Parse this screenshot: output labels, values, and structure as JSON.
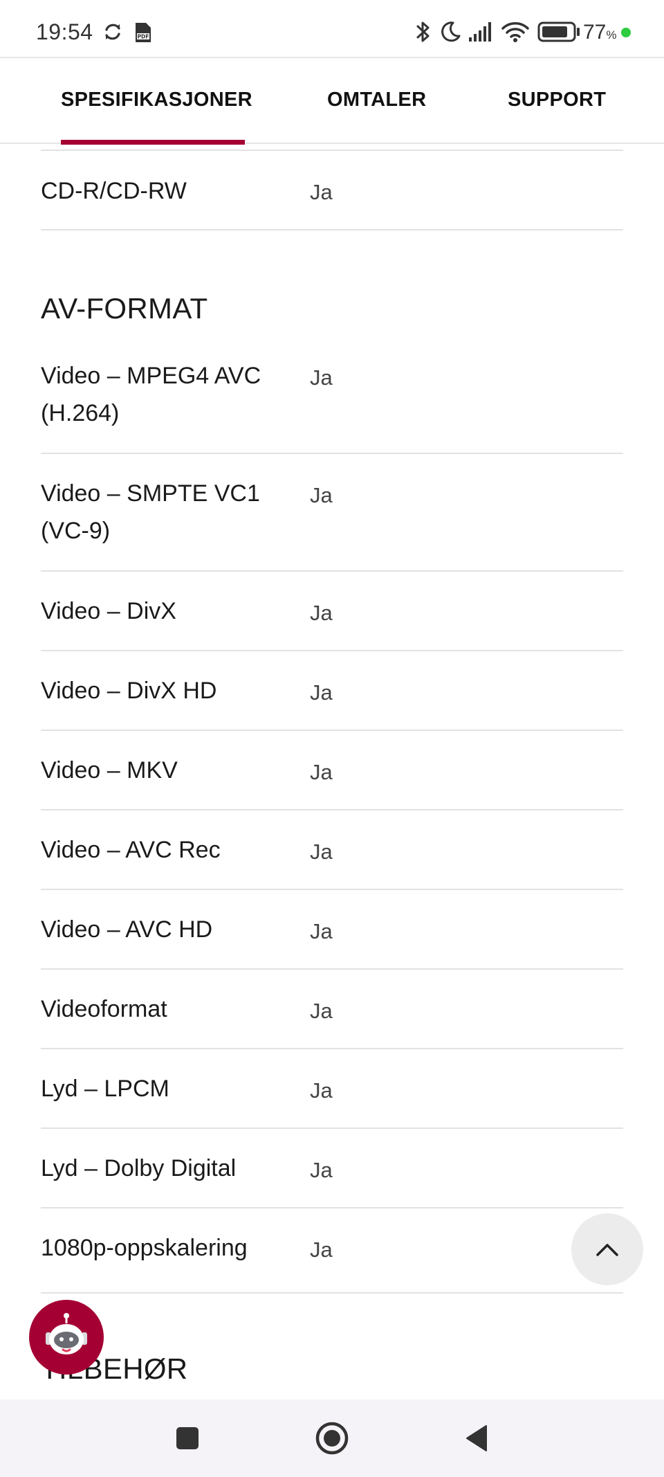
{
  "status_bar": {
    "time": "19:54",
    "battery_percent": "77",
    "battery_unit": "%",
    "icons": [
      "sync-icon",
      "pdf-icon",
      "bluetooth-icon",
      "moon-icon",
      "signal-icon",
      "wifi-icon",
      "battery-icon"
    ],
    "battery_level": 0.77
  },
  "tabs": [
    {
      "label": "SPESIFIKASJONER",
      "active": true
    },
    {
      "label": "OMTALER",
      "active": false
    },
    {
      "label": "SUPPORT",
      "active": false
    }
  ],
  "accent_color": "#a50034",
  "disc_row": {
    "label": "CD-R/CD-RW",
    "value": "Ja"
  },
  "av_section": {
    "title": "AV-FORMAT",
    "rows": [
      {
        "label": "Video – MPEG4 AVC (H.264)",
        "value": "Ja"
      },
      {
        "label": "Video – SMPTE VC1 (VC-9)",
        "value": "Ja"
      },
      {
        "label": "Video – DivX",
        "value": "Ja"
      },
      {
        "label": "Video – DivX HD",
        "value": "Ja"
      },
      {
        "label": "Video – MKV",
        "value": "Ja"
      },
      {
        "label": "Video – AVC Rec",
        "value": "Ja"
      },
      {
        "label": "Video – AVC HD",
        "value": "Ja"
      },
      {
        "label": "Videoformat",
        "value": "Ja"
      },
      {
        "label": "Lyd – LPCM",
        "value": "Ja"
      },
      {
        "label": "Lyd – Dolby Digital",
        "value": "Ja"
      },
      {
        "label": "1080p-oppskalering",
        "value": "Ja"
      }
    ]
  },
  "next_section": {
    "title": "TILBEHØR"
  },
  "floating": {
    "scroll_top_icon": "chevron-up-icon",
    "chatbot_icon": "robot-icon"
  },
  "nav_bar": {
    "icons": [
      "recents-square-icon",
      "home-circle-icon",
      "back-triangle-icon"
    ]
  }
}
